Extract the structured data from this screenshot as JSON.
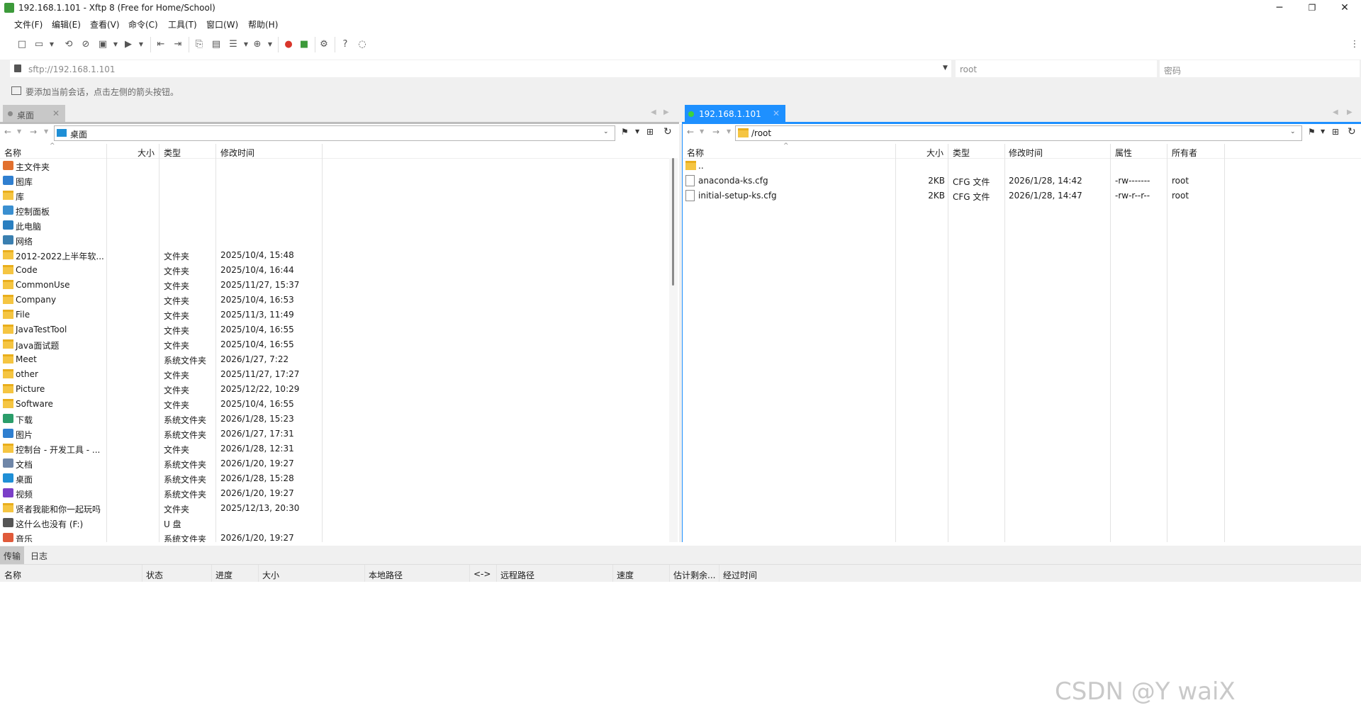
{
  "window": {
    "title": "192.168.1.101 - Xftp 8 (Free for Home/School)",
    "minimize": "─",
    "maximize": "❐",
    "close": "✕"
  },
  "menu": [
    "文件(F)",
    "编辑(E)",
    "查看(V)",
    "命令(C)",
    "工具(T)",
    "窗口(W)",
    "帮助(H)"
  ],
  "address": {
    "url_placeholder": "sftp://192.168.1.101",
    "user_placeholder": "root",
    "password_placeholder": "密码"
  },
  "hint": "要添加当前会话，点击左侧的箭头按钮。",
  "tabs": {
    "local": "桌面",
    "remote": "192.168.1.101"
  },
  "local": {
    "path": "桌面",
    "columns": [
      "名称",
      "大小",
      "类型",
      "修改时间"
    ],
    "rows": [
      {
        "name": "主文件夹",
        "type": "",
        "modified": "",
        "icon": "home-icon"
      },
      {
        "name": "图库",
        "type": "",
        "modified": "",
        "icon": "gallery-icon"
      },
      {
        "name": "库",
        "type": "",
        "modified": "",
        "icon": "folder-icon"
      },
      {
        "name": "控制面板",
        "type": "",
        "modified": "",
        "icon": "control-panel-icon"
      },
      {
        "name": "此电脑",
        "type": "",
        "modified": "",
        "icon": "computer-icon"
      },
      {
        "name": "网络",
        "type": "",
        "modified": "",
        "icon": "network-icon"
      },
      {
        "name": "2012-2022上半年软...",
        "type": "文件夹",
        "modified": "2025/10/4, 15:48",
        "icon": "folder-icon"
      },
      {
        "name": "Code",
        "type": "文件夹",
        "modified": "2025/10/4, 16:44",
        "icon": "folder-icon"
      },
      {
        "name": "CommonUse",
        "type": "文件夹",
        "modified": "2025/11/27, 15:37",
        "icon": "folder-icon"
      },
      {
        "name": "Company",
        "type": "文件夹",
        "modified": "2025/10/4, 16:53",
        "icon": "folder-icon"
      },
      {
        "name": "File",
        "type": "文件夹",
        "modified": "2025/11/3, 11:49",
        "icon": "folder-icon"
      },
      {
        "name": "JavaTestTool",
        "type": "文件夹",
        "modified": "2025/10/4, 16:55",
        "icon": "folder-icon"
      },
      {
        "name": "Java面试题",
        "type": "文件夹",
        "modified": "2025/10/4, 16:55",
        "icon": "folder-icon"
      },
      {
        "name": "Meet",
        "type": "系统文件夹",
        "modified": "2026/1/27, 7:22",
        "icon": "folder-icon"
      },
      {
        "name": "other",
        "type": "文件夹",
        "modified": "2025/11/27, 17:27",
        "icon": "folder-icon"
      },
      {
        "name": "Picture",
        "type": "文件夹",
        "modified": "2025/12/22, 10:29",
        "icon": "folder-icon"
      },
      {
        "name": "Software",
        "type": "文件夹",
        "modified": "2025/10/4, 16:55",
        "icon": "folder-icon"
      },
      {
        "name": "下载",
        "type": "系统文件夹",
        "modified": "2026/1/28, 15:23",
        "icon": "download-icon"
      },
      {
        "name": "图片",
        "type": "系统文件夹",
        "modified": "2026/1/27, 17:31",
        "icon": "pictures-icon"
      },
      {
        "name": "控制台 - 开发工具 - ...",
        "type": "文件夹",
        "modified": "2026/1/28, 12:31",
        "icon": "folder-icon"
      },
      {
        "name": "文档",
        "type": "系统文件夹",
        "modified": "2026/1/20, 19:27",
        "icon": "documents-icon"
      },
      {
        "name": "桌面",
        "type": "系统文件夹",
        "modified": "2026/1/28, 15:28",
        "icon": "desktop-icon"
      },
      {
        "name": "视频",
        "type": "系统文件夹",
        "modified": "2026/1/20, 19:27",
        "icon": "videos-icon"
      },
      {
        "name": "贤者我能和你一起玩吗",
        "type": "文件夹",
        "modified": "2025/12/13, 20:30",
        "icon": "folder-icon"
      },
      {
        "name": "这什么也没有 (F:)",
        "type": "U 盘",
        "modified": "",
        "icon": "usb-drive-icon"
      },
      {
        "name": "音乐",
        "type": "系统文件夹",
        "modified": "2026/1/20, 19:27",
        "icon": "music-icon"
      }
    ]
  },
  "remote": {
    "path": "/root",
    "columns": [
      "名称",
      "大小",
      "类型",
      "修改时间",
      "属性",
      "所有者"
    ],
    "rows": [
      {
        "name": "..",
        "size": "",
        "type": "",
        "modified": "",
        "attr": "",
        "owner": "",
        "icon": "folder-icon"
      },
      {
        "name": "anaconda-ks.cfg",
        "size": "2KB",
        "type": "CFG 文件",
        "modified": "2026/1/28, 14:42",
        "attr": "-rw-------",
        "owner": "root",
        "icon": "file-icon"
      },
      {
        "name": "initial-setup-ks.cfg",
        "size": "2KB",
        "type": "CFG 文件",
        "modified": "2026/1/28, 14:47",
        "attr": "-rw-r--r--",
        "owner": "root",
        "icon": "file-icon"
      }
    ]
  },
  "bottom": {
    "tabs": [
      "传输",
      "日志"
    ],
    "columns": [
      "名称",
      "状态",
      "进度",
      "大小",
      "本地路径",
      "<->",
      "远程路径",
      "速度",
      "估计剩余...",
      "经过时间"
    ]
  },
  "watermark": "CSDN @Y waiX"
}
